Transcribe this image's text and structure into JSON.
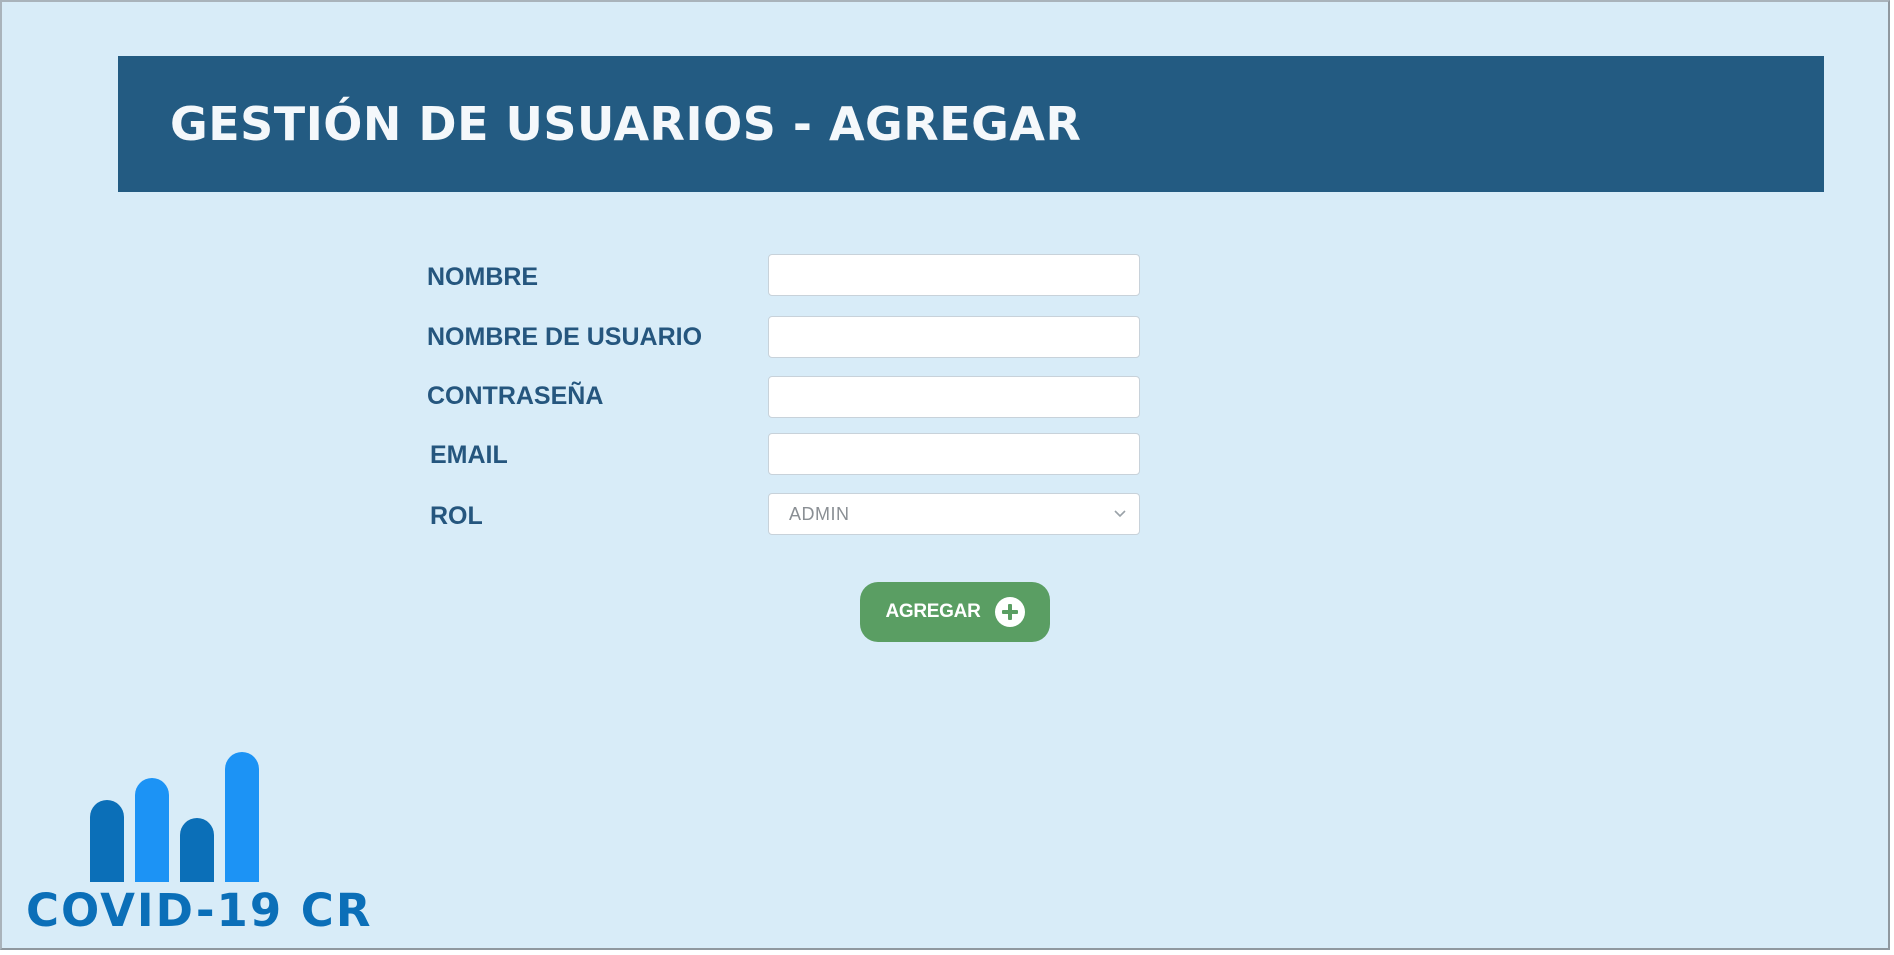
{
  "header": {
    "title": "GESTIÓN DE USUARIOS - AGREGAR"
  },
  "form": {
    "fields": [
      {
        "label": "NOMBRE",
        "value": "",
        "placeholder": ""
      },
      {
        "label": "NOMBRE DE USUARIO",
        "value": "",
        "placeholder": ""
      },
      {
        "label": "CONTRASEÑA",
        "value": "",
        "placeholder": ""
      },
      {
        "label": "EMAIL",
        "value": "",
        "placeholder": ""
      }
    ],
    "role": {
      "label": "ROL",
      "selected": "ADMIN"
    },
    "submit_label": "AGREGAR"
  },
  "logo": {
    "text": "COVID-19 CR"
  },
  "colors": {
    "background": "#d8ecf8",
    "header_bar": "#235b82",
    "label_text": "#25567e",
    "button_green": "#5a9e63",
    "logo_dark_blue": "#0b6fb8",
    "logo_light_blue": "#1c93f5"
  },
  "icons": {
    "submit": "plus-circle-icon",
    "select": "chevron-down-icon"
  }
}
